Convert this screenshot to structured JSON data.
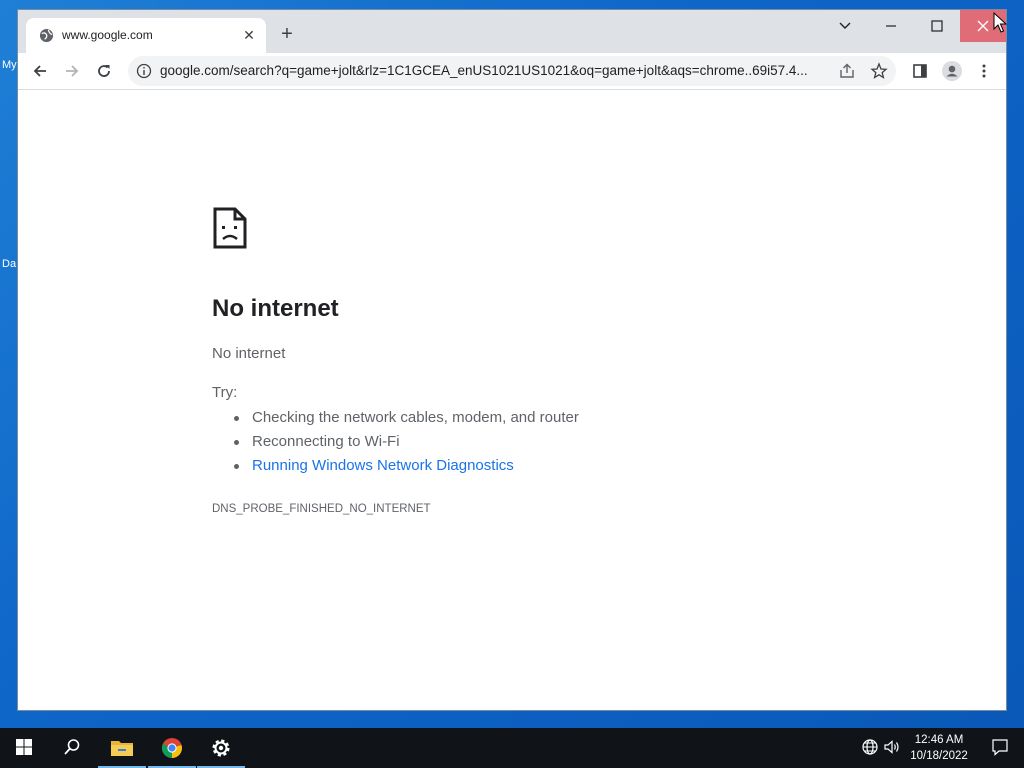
{
  "desktop": {
    "fragments": [
      "My",
      "Da"
    ]
  },
  "browser": {
    "tab": {
      "title": "www.google.com",
      "close_label": "✕",
      "favicon": "globe-icon"
    },
    "new_tab_label": "+",
    "window_controls": [
      "tab-search",
      "minimize",
      "maximize",
      "close"
    ],
    "address_bar": {
      "url": "google.com/search?q=game+jolt&rlz=1C1GCEA_enUS1021US1021&oq=game+jolt&aqs=chrome..69i57.4..."
    },
    "toolbar_icons": [
      "back-icon",
      "forward-icon",
      "reload-icon",
      "info-icon",
      "share-icon",
      "star-icon",
      "side-panel-icon",
      "profile-icon",
      "menu-icon"
    ]
  },
  "error_page": {
    "heading": "No internet",
    "subheading": "No internet",
    "try_label": "Try:",
    "suggestions": [
      "Checking the network cables, modem, and router",
      "Reconnecting to Wi-Fi",
      "Running Windows Network Diagnostics"
    ],
    "error_code": "DNS_PROBE_FINISHED_NO_INTERNET"
  },
  "taskbar": {
    "time": "12:46 AM",
    "date": "10/18/2022",
    "items": [
      "start-icon",
      "search-icon",
      "file-explorer-icon",
      "chrome-icon",
      "settings-icon"
    ],
    "tray": [
      "network-icon",
      "volume-icon",
      "notifications-icon"
    ]
  },
  "colors": {
    "link": "#1a73e8",
    "close_hover": "#e06c78",
    "desktop": "#0e66c8"
  }
}
